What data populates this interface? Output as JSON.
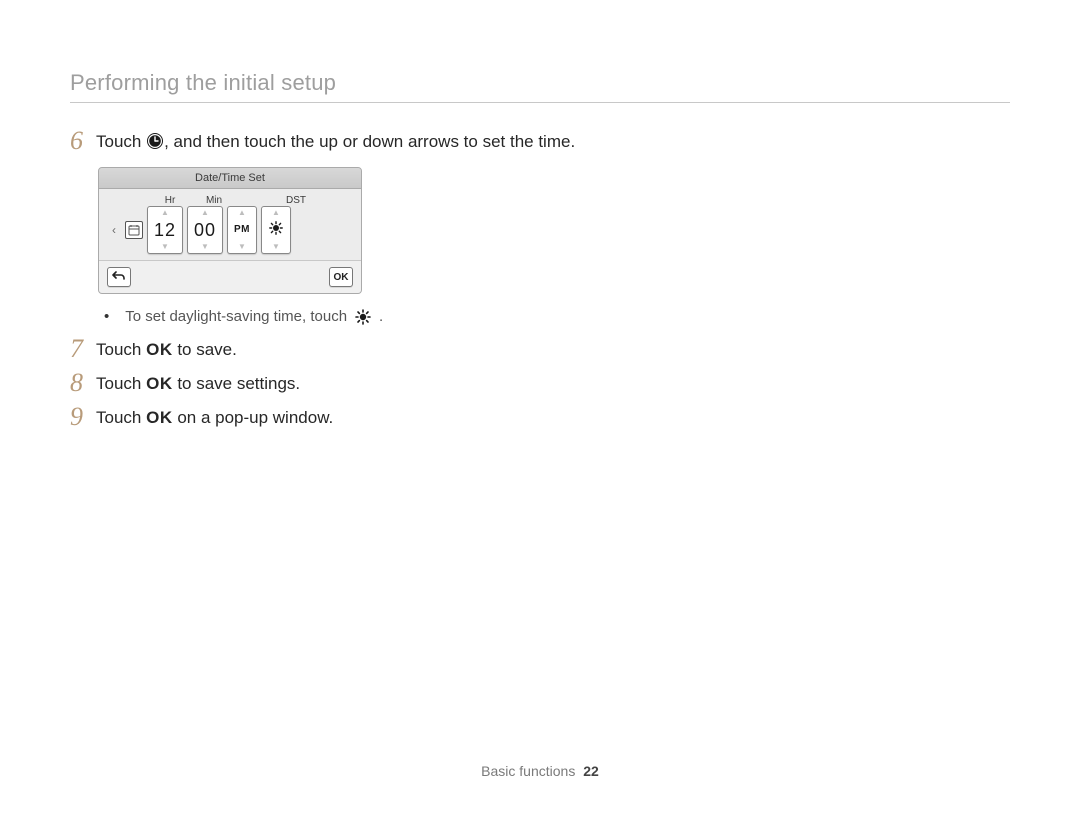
{
  "header": {
    "title": "Performing the initial setup"
  },
  "steps": {
    "s6": {
      "num": "6",
      "text_before": "Touch ",
      "text_after": ", and then touch the up or down arrows to set the time."
    },
    "s7": {
      "num": "7",
      "text_before": "Touch ",
      "ok": "OK",
      "text_after": " to save."
    },
    "s8": {
      "num": "8",
      "text_before": "Touch ",
      "ok": "OK",
      "text_after": " to save settings."
    },
    "s9": {
      "num": "9",
      "text_before": "Touch ",
      "ok": "OK",
      "text_after": " on a pop-up window."
    }
  },
  "bullet": {
    "text_before": "To set daylight-saving time, touch ",
    "text_after": "."
  },
  "device_screenshot": {
    "title": "Date/Time Set",
    "labels": {
      "hr": "Hr",
      "min": "Min",
      "dst": "DST"
    },
    "values": {
      "hr": "12",
      "min": "00",
      "ampm": "PM",
      "dst": "✱"
    },
    "footer": {
      "back": "↶",
      "ok": "OK"
    }
  },
  "footer": {
    "section": "Basic functions",
    "page": "22"
  }
}
